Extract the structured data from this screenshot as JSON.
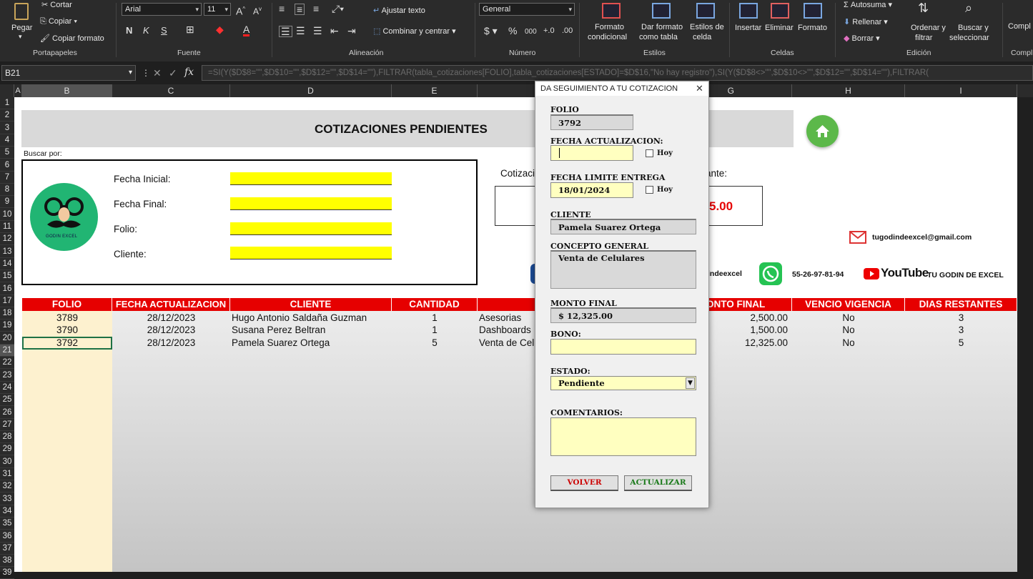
{
  "ribbon": {
    "clipboard": {
      "paste": "Pegar",
      "cut": "Cortar",
      "copy": "Copiar",
      "format_painter": "Copiar formato",
      "group": "Portapapeles"
    },
    "font": {
      "name": "Arial",
      "size": "11",
      "group": "Fuente",
      "bold": "N",
      "italic": "K",
      "underline": "S"
    },
    "alignment": {
      "wrap": "Ajustar texto",
      "merge": "Combinar y centrar",
      "group": "Alineación"
    },
    "number": {
      "format": "General",
      "group": "Número",
      "currency": "$",
      "percent": "%",
      "thousands": "000"
    },
    "styles": {
      "conditional": "Formato\ncondicional",
      "conditional_1": "Formato",
      "conditional_2": "condicional",
      "table_1": "Dar formato",
      "table_2": "como tabla",
      "cell_1": "Estilos de",
      "cell_2": "celda",
      "group": "Estilos"
    },
    "cells": {
      "insert": "Insertar",
      "delete": "Eliminar",
      "format": "Formato",
      "group": "Celdas"
    },
    "editing": {
      "autosum": "Autosuma",
      "fill": "Rellenar",
      "clear": "Borrar",
      "sort_1": "Ordenar y",
      "sort_2": "filtrar",
      "find_1": "Buscar y",
      "find_2": "seleccionar",
      "group": "Edición"
    },
    "extra": {
      "complement": "Compl",
      "complement_group": "Compl"
    }
  },
  "formula_bar": {
    "name_box": "B21",
    "formula": "=SI(Y($D$8=\"\",$D$10=\"\",$D$12=\"\",$D$14=\"\"),FILTRAR(tabla_cotizaciones[FOLIO],tabla_cotizaciones[ESTADO]=$D$16,\"No hay registro\"),SI(Y($D$8<>\"\",$D$10<>\"\",$D$12=\"\",$D$14=\"\"),FILTRAR("
  },
  "columns": [
    "A",
    "B",
    "C",
    "D",
    "E",
    "F",
    "G",
    "H",
    "I"
  ],
  "rows": [
    "1",
    "2",
    "3",
    "4",
    "5",
    "6",
    "7",
    "8",
    "9",
    "10",
    "11",
    "12",
    "13",
    "14",
    "15",
    "16",
    "17",
    "18",
    "19",
    "20",
    "21",
    "22",
    "23",
    "24",
    "25",
    "26",
    "27",
    "28",
    "29",
    "30",
    "31",
    "32",
    "33",
    "34",
    "35",
    "36",
    "37",
    "38",
    "39"
  ],
  "sheet": {
    "title": "COTIZACIONES PENDIENTES",
    "search_by": "Buscar por:",
    "filters": {
      "start_date": "Fecha Inicial:",
      "end_date": "Fecha Final:",
      "folio": "Folio:",
      "client": "Cliente:"
    },
    "logo_text": "GODIN EXCEL",
    "cotiza_label": "Cotizaci",
    "ante_label": "ante:",
    "amount_partial": "5.00",
    "email": "tugodindeexcel@gmail.com",
    "handle": "indeexcel",
    "phone": "55-26-97-81-94",
    "youtube": "YouTube",
    "channel": "TU GODIN DE EXCEL"
  },
  "table": {
    "headers": [
      "FOLIO",
      "FECHA ACTUALIZACION",
      "CLIENTE",
      "CANTIDAD",
      "CO",
      "ONTO FINAL",
      "VENCIO VIGENCIA",
      "DIAS RESTANTES"
    ],
    "rows": [
      {
        "folio": "3789",
        "date": "28/12/2023",
        "client": "Hugo Antonio Saldaña Guzman",
        "qty": "1",
        "concept": "Asesorias",
        "amount": "2,500.00",
        "expired": "No",
        "days": "3"
      },
      {
        "folio": "3790",
        "date": "28/12/2023",
        "client": "Susana Perez Beltran",
        "qty": "1",
        "concept": "Dashboards",
        "amount": "1,500.00",
        "expired": "No",
        "days": "3"
      },
      {
        "folio": "3792",
        "date": "28/12/2023",
        "client": "Pamela Suarez Ortega",
        "qty": "5",
        "concept": "Venta de Cel",
        "amount": "12,325.00",
        "expired": "No",
        "days": "5"
      }
    ]
  },
  "dialog": {
    "title": "DA SEGUIMIENTO A TU COTIZACION",
    "close": "✕",
    "folio_label": "FOLIO",
    "folio_value": "3792",
    "update_date_label": "FECHA ACTUALIZACION:",
    "update_date_value": "",
    "today_label": "Hoy",
    "deadline_label": "FECHA LIMITE ENTREGA",
    "deadline_value": "18/01/2024",
    "client_label": "CLIENTE",
    "client_value": "Pamela Suarez Ortega",
    "concept_label": "CONCEPTO GENERAL",
    "concept_value": "Venta de Celulares",
    "amount_label": "MONTO FINAL",
    "amount_value": "$ 12,325.00",
    "bonus_label": "BONO:",
    "bonus_value": "",
    "status_label": "ESTADO:",
    "status_value": "Pendiente",
    "comments_label": "COMENTARIOS:",
    "comments_value": "",
    "back_button": "VOLVER",
    "update_button": "ACTUALIZAR"
  },
  "colors": {
    "header_red": "#e60000",
    "filter_yellow": "#ffff00",
    "amount_red": "#e60000",
    "home_green": "#5cb84a",
    "back_text": "#cc0000",
    "update_text": "#1a7a1a"
  }
}
